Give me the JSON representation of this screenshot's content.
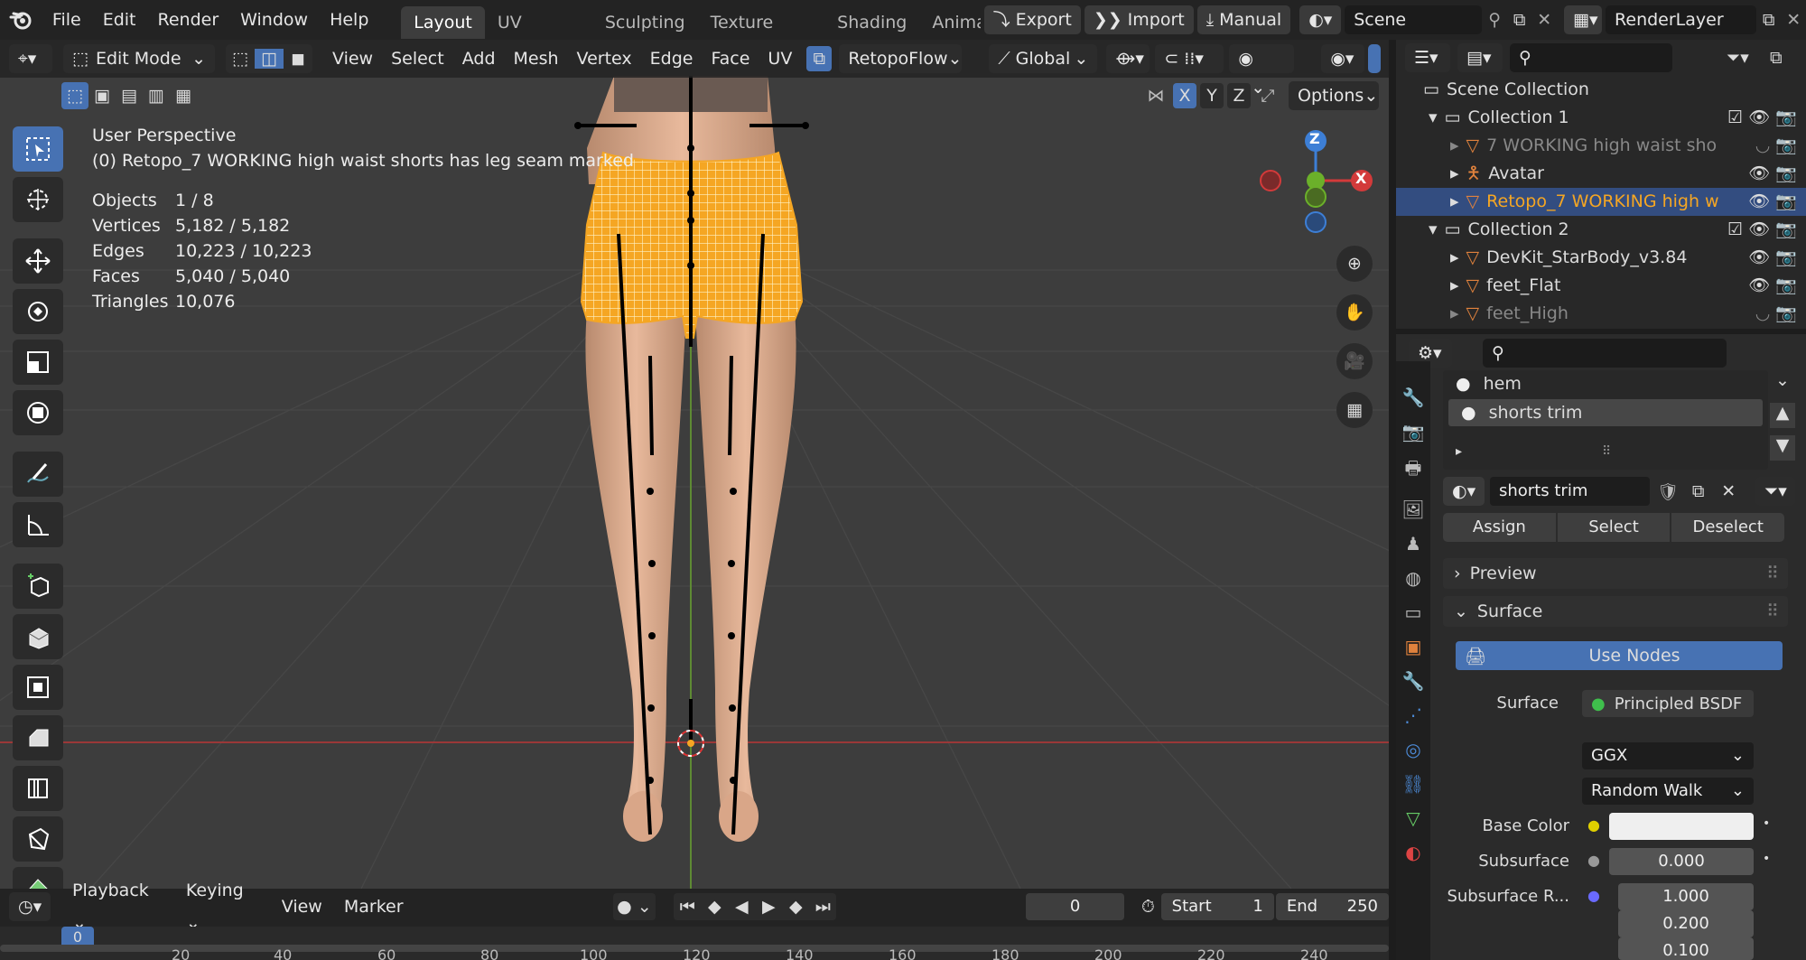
{
  "topbar": {
    "menus": [
      "File",
      "Edit",
      "Render",
      "Window",
      "Help"
    ],
    "workspaces": [
      "Layout",
      "UV Editing",
      "Sculpting",
      "Texture Paint",
      "Shading",
      "Anima"
    ],
    "active_workspace": "Layout",
    "export_label": "Export",
    "import_label": "Import",
    "manual_label": "Manual",
    "scene_name": "Scene",
    "render_layer": "RenderLayer"
  },
  "viewport_header": {
    "mode": "Edit Mode",
    "menus": [
      "View",
      "Select",
      "Add",
      "Mesh",
      "Vertex",
      "Edge",
      "Face",
      "UV"
    ],
    "addon": "RetopoFlow",
    "orientation": "Global",
    "options_label": "Options",
    "axis_x": "X",
    "axis_y": "Y",
    "axis_z": "Z"
  },
  "overlay": {
    "perspective": "User Perspective",
    "object_line": "(0) Retopo_7 WORKING high waist shorts has leg seam marked",
    "stats": [
      {
        "label": "Objects",
        "value": "1 / 8"
      },
      {
        "label": "Vertices",
        "value": "5,182 / 5,182"
      },
      {
        "label": "Edges",
        "value": "10,223 / 10,223"
      },
      {
        "label": "Faces",
        "value": "5,040 / 5,040"
      },
      {
        "label": "Triangles",
        "value": "10,076"
      }
    ]
  },
  "gizmo": {
    "z": "Z",
    "x": "X"
  },
  "outliner": {
    "scene_collection": "Scene Collection",
    "collection1": "Collection 1",
    "item1": "7 WORKING high waist sho",
    "item2": "Avatar",
    "item3": "Retopo_7 WORKING high w",
    "collection2": "Collection 2",
    "item4": "DevKit_StarBody_v3.84",
    "item5": "feet_Flat",
    "item6": "feet_High"
  },
  "material": {
    "slots": [
      "hem",
      "shorts trim"
    ],
    "name": "shorts trim",
    "assign": "Assign",
    "select": "Select",
    "deselect": "Deselect",
    "preview": "Preview",
    "surface_section": "Surface",
    "use_nodes": "Use Nodes",
    "surface_label": "Surface",
    "surface_value": "Principled BSDF",
    "distribution": "GGX",
    "subsurface_method": "Random Walk",
    "base_color_label": "Base Color",
    "subsurface_label": "Subsurface",
    "subsurface_value": "0.000",
    "subsurface_r_label": "Subsurface R...",
    "subsurface_r_values": [
      "1.000",
      "0.200",
      "0.100"
    ],
    "base_color": "#efefef"
  },
  "timeline": {
    "playback": "Playback",
    "keying": "Keying",
    "view": "View",
    "marker": "Marker",
    "current_frame": "0",
    "start_label": "Start",
    "start_value": "1",
    "end_label": "End",
    "end_value": "250",
    "ruler": [
      "0",
      "20",
      "40",
      "60",
      "80",
      "100",
      "120",
      "140",
      "160",
      "180",
      "200",
      "220",
      "240"
    ]
  },
  "colors": {
    "accent": "#4772b3",
    "selected_object": "#f5a623",
    "floor_red": "#b03030",
    "floor_green": "#6a9a3a"
  }
}
